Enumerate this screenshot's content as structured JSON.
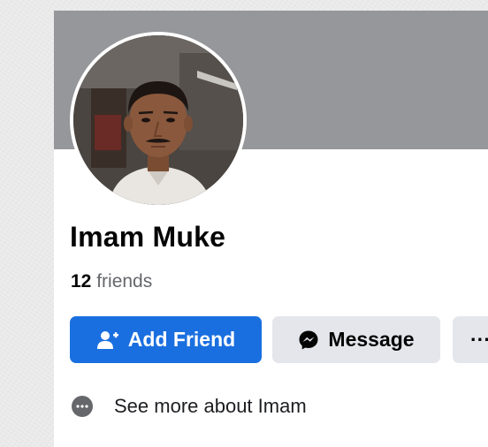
{
  "profile": {
    "name": "Imam Muke",
    "friends_count": "12",
    "friends_label": "friends",
    "avatar_alt": "profile-photo"
  },
  "actions": {
    "add_friend_label": "Add Friend",
    "message_label": "Message",
    "more_label": "···"
  },
  "about": {
    "label": "See more about Imam"
  },
  "icons": {
    "add_friend": "person-plus-icon",
    "message": "messenger-icon",
    "more": "ellipsis-icon",
    "about": "more-dots-icon"
  },
  "colors": {
    "cover": "#96979a",
    "primary_button": "#1a6fe0",
    "secondary_button": "#e4e6eb",
    "muted_text": "#65676b"
  }
}
